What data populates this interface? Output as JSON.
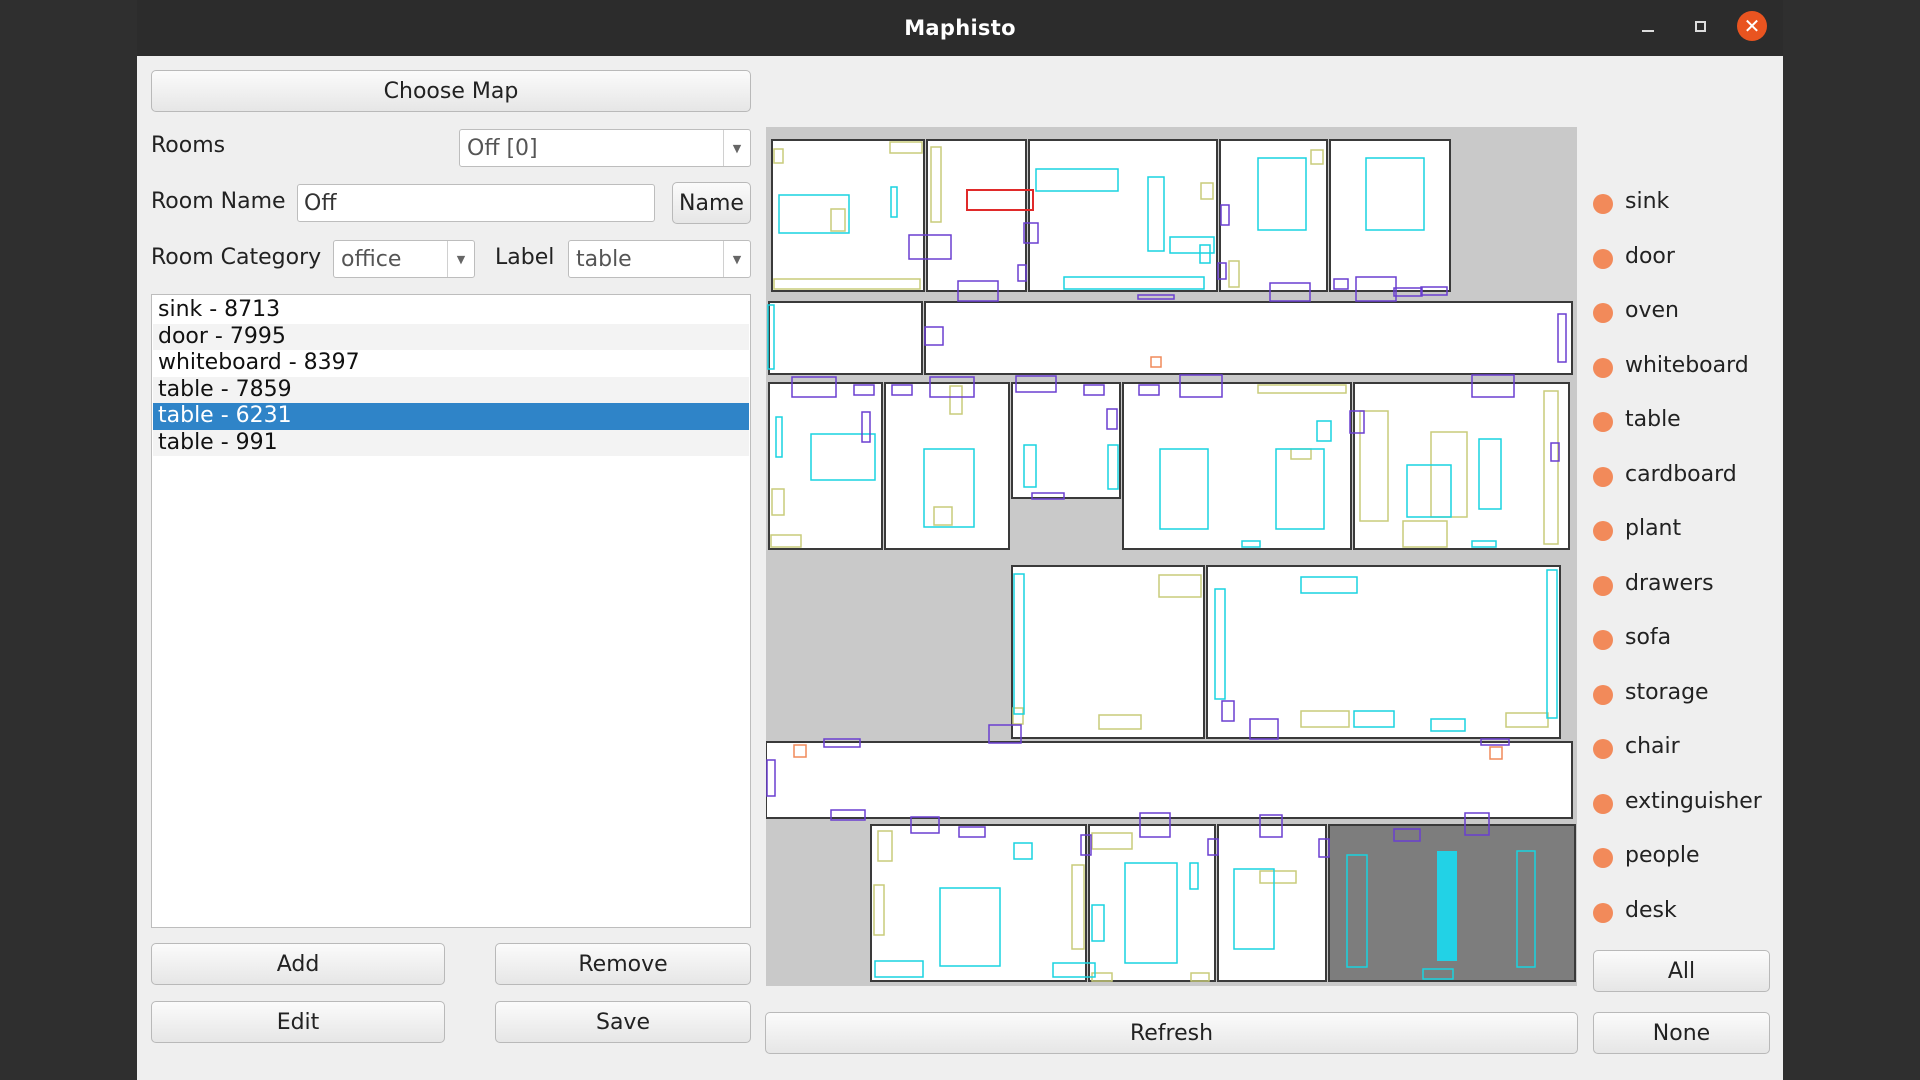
{
  "window": {
    "title": "Maphisto"
  },
  "left_panel": {
    "choose_map_label": "Choose Map",
    "rooms_label": "Rooms",
    "rooms_selected": "Off [0]",
    "room_name_label": "Room Name",
    "room_name_value": "Off",
    "name_button": "Name",
    "room_category_label": "Room Category",
    "room_category_value": "office",
    "label_label": "Label",
    "label_value": "table",
    "items": [
      {
        "text": "sink - 8713"
      },
      {
        "text": "door - 7995"
      },
      {
        "text": "whiteboard - 8397"
      },
      {
        "text": "table - 7859"
      },
      {
        "text": "table - 6231",
        "selected": true
      },
      {
        "text": "table - 991"
      }
    ],
    "add_button": "Add",
    "remove_button": "Remove",
    "edit_button": "Edit",
    "save_button": "Save"
  },
  "map": {
    "refresh_button": "Refresh"
  },
  "legend": {
    "dot_color": "#f28a5a",
    "items": [
      {
        "label": "sink"
      },
      {
        "label": "door"
      },
      {
        "label": "oven"
      },
      {
        "label": "whiteboard"
      },
      {
        "label": "table"
      },
      {
        "label": "cardboard"
      },
      {
        "label": "plant"
      },
      {
        "label": "drawers"
      },
      {
        "label": "sofa"
      },
      {
        "label": "storage"
      },
      {
        "label": "chair"
      },
      {
        "label": "extinguisher"
      },
      {
        "label": "people"
      },
      {
        "label": "desk"
      }
    ],
    "all_button": "All",
    "none_button": "None"
  },
  "colors": {
    "table": "#19d3e0",
    "door": "#6a3fd0",
    "whiteboard": "#c9cc7a",
    "desk_highlight": "#22d2e6",
    "sink": "#e02a2a",
    "selected_room": "#7d7d7d",
    "accent": "#e95420",
    "selection": "#2f84c8"
  }
}
